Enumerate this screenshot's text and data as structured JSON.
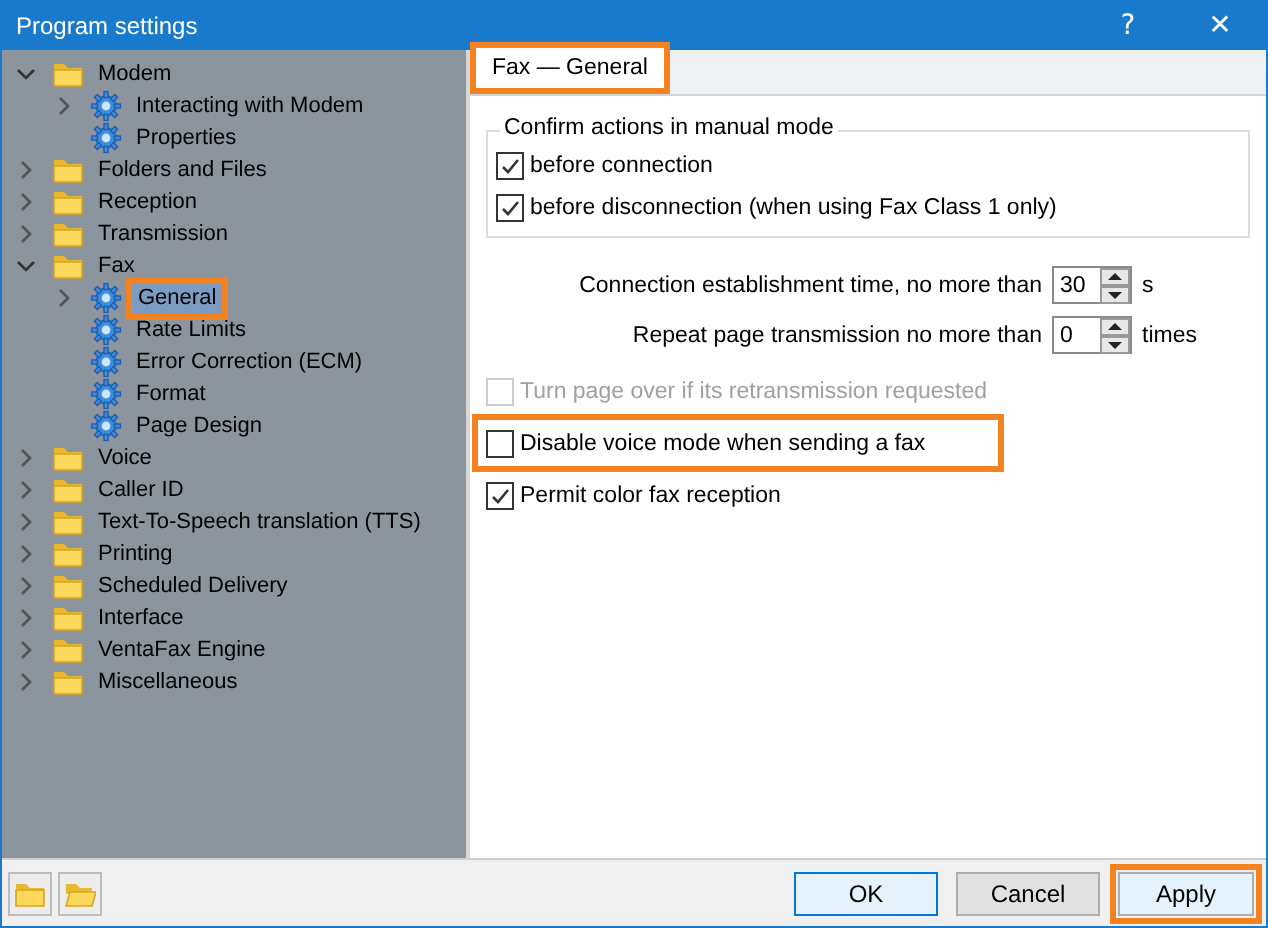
{
  "window": {
    "title": "Program settings",
    "help": "?",
    "close": "✕"
  },
  "tree": [
    {
      "label": "Modem",
      "kind": "folder",
      "expandable": true,
      "expanded": true,
      "selected": false,
      "highlighted": false,
      "children": [
        {
          "label": "Interacting with Modem",
          "kind": "gear",
          "expandable": true,
          "expanded": false,
          "selected": false,
          "highlighted": false
        },
        {
          "label": "Properties",
          "kind": "gear",
          "expandable": false,
          "selected": false,
          "highlighted": false
        }
      ]
    },
    {
      "label": "Folders and Files",
      "kind": "folder",
      "expandable": true,
      "expanded": false,
      "selected": false,
      "highlighted": false
    },
    {
      "label": "Reception",
      "kind": "folder",
      "expandable": true,
      "expanded": false,
      "selected": false,
      "highlighted": false
    },
    {
      "label": "Transmission",
      "kind": "folder",
      "expandable": true,
      "expanded": false,
      "selected": false,
      "highlighted": false
    },
    {
      "label": "Fax",
      "kind": "folder",
      "expandable": true,
      "expanded": true,
      "selected": false,
      "highlighted": false,
      "children": [
        {
          "label": "General",
          "kind": "gear",
          "expandable": true,
          "expanded": false,
          "selected": true,
          "highlighted": true
        },
        {
          "label": "Rate Limits",
          "kind": "gear",
          "expandable": false,
          "selected": false,
          "highlighted": false
        },
        {
          "label": "Error Correction (ECM)",
          "kind": "gear",
          "expandable": false,
          "selected": false,
          "highlighted": false
        },
        {
          "label": "Format",
          "kind": "gear",
          "expandable": false,
          "selected": false,
          "highlighted": false
        },
        {
          "label": "Page Design",
          "kind": "gear",
          "expandable": false,
          "selected": false,
          "highlighted": false
        }
      ]
    },
    {
      "label": "Voice",
      "kind": "folder",
      "expandable": true,
      "expanded": false,
      "selected": false,
      "highlighted": false
    },
    {
      "label": "Caller ID",
      "kind": "folder",
      "expandable": true,
      "expanded": false,
      "selected": false,
      "highlighted": false
    },
    {
      "label": "Text-To-Speech translation (TTS)",
      "kind": "folder",
      "expandable": true,
      "expanded": false,
      "selected": false,
      "highlighted": false
    },
    {
      "label": "Printing",
      "kind": "folder",
      "expandable": true,
      "expanded": false,
      "selected": false,
      "highlighted": false
    },
    {
      "label": "Scheduled Delivery",
      "kind": "folder",
      "expandable": true,
      "expanded": false,
      "selected": false,
      "highlighted": false
    },
    {
      "label": "Interface",
      "kind": "folder",
      "expandable": true,
      "expanded": false,
      "selected": false,
      "highlighted": false
    },
    {
      "label": "VentaFax Engine",
      "kind": "folder",
      "expandable": true,
      "expanded": false,
      "selected": false,
      "highlighted": false
    },
    {
      "label": "Miscellaneous",
      "kind": "folder",
      "expandable": true,
      "expanded": false,
      "selected": false,
      "highlighted": false
    }
  ],
  "tab": {
    "label": "Fax — General",
    "selected": true,
    "highlighted": true
  },
  "group": {
    "title": "Confirm actions in manual mode",
    "options": [
      {
        "label": "before connection",
        "checked": true
      },
      {
        "label": "before disconnection (when using Fax Class 1 only)",
        "checked": true
      }
    ]
  },
  "spinners": [
    {
      "label": "Connection establishment time, no more than",
      "value": "30",
      "unit": "s"
    },
    {
      "label": "Repeat page transmission no more than",
      "value": "0",
      "unit": "times"
    }
  ],
  "options": [
    {
      "label": "Turn page over if its retransmission requested",
      "checked": false,
      "disabled": true,
      "highlighted": false
    },
    {
      "label": "Disable voice mode when sending a fax",
      "checked": false,
      "disabled": false,
      "highlighted": true
    },
    {
      "label": "Permit color fax reception",
      "checked": true,
      "disabled": false,
      "highlighted": false
    }
  ],
  "buttons": [
    {
      "label": "OK",
      "default": true,
      "highlighted": false
    },
    {
      "label": "Cancel",
      "default": false,
      "highlighted": false
    },
    {
      "label": "Apply",
      "default": false,
      "highlighted": true
    }
  ]
}
